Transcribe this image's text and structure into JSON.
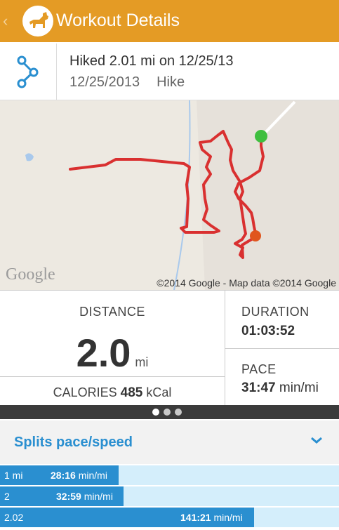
{
  "header": {
    "title": "Workout Details",
    "back_icon": "chevron-left-icon",
    "logo_icon": "dog-logo-icon",
    "accent": "#E49B25"
  },
  "summary": {
    "title": "Hiked 2.01 mi on 12/25/13",
    "date": "12/25/2013",
    "activity": "Hike",
    "route_icon": "route-icon",
    "icon_color": "#2A8FD0"
  },
  "map": {
    "logo_text": "Google",
    "attribution": "©2014 Google - Map data ©2014 Google",
    "route_color": "#D93030",
    "start_marker_color": "#3FBF3F",
    "end_marker_color": "#E0561E"
  },
  "stats": {
    "distance_label": "DISTANCE",
    "distance_value": "2.0",
    "distance_unit": "mi",
    "calories_label": "CALORIES",
    "calories_value": "485",
    "calories_unit": "kCal",
    "duration_label": "DURATION",
    "duration_value": "01:03:52",
    "pace_label": "PACE",
    "pace_value": "31:47",
    "pace_unit": "min/mi"
  },
  "pager": {
    "count": 3,
    "active": 0
  },
  "splits": {
    "title": "Splits pace/speed",
    "expand_icon": "chevron-down-icon",
    "unit": "min/mi",
    "rows": [
      {
        "label": "1 mi",
        "pace": "28:16",
        "fill_fraction": 0.35
      },
      {
        "label": "2",
        "pace": "32:59",
        "fill_fraction": 0.365
      },
      {
        "label": "2.02",
        "pace": "141:21",
        "fill_fraction": 0.75
      }
    ]
  }
}
